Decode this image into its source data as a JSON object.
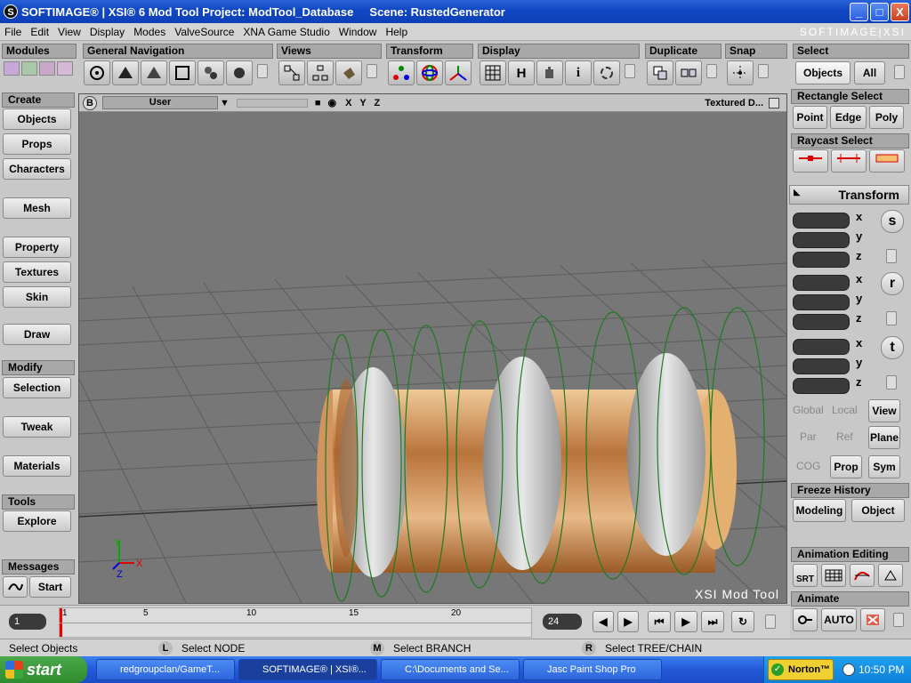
{
  "titlebar": {
    "app_icon": "S",
    "title": "SOFTIMAGE® | XSI® 6 Mod Tool Project: ModTool_Database     Scene: RustedGenerator"
  },
  "window_controls": {
    "minimize": "_",
    "maximize": "□",
    "close": "X"
  },
  "menu": [
    "File",
    "Edit",
    "View",
    "Display",
    "Modes",
    "ValveSource",
    "XNA Game Studio",
    "Window",
    "Help"
  ],
  "brand": "SOFTIMAGE|XSI",
  "toolbar": {
    "modules": "Modules",
    "general_navigation": "General Navigation",
    "views": "Views",
    "transform": "Transform",
    "display": "Display",
    "display_h": "H",
    "display_i": "i",
    "duplicate": "Duplicate",
    "snap": "Snap",
    "select": "Select"
  },
  "left": {
    "create_header": "Create",
    "objects": "Objects",
    "props": "Props",
    "characters": "Characters",
    "mesh": "Mesh",
    "property": "Property",
    "textures": "Textures",
    "skin": "Skin",
    "draw": "Draw",
    "modify_header": "Modify",
    "selection": "Selection",
    "tweak": "Tweak",
    "materials": "Materials",
    "tools_header": "Tools",
    "explore": "Explore",
    "messages_header": "Messages",
    "start": "Start"
  },
  "viewport": {
    "b_label": "B",
    "camera": "User",
    "axes": "X Y Z",
    "mode": "Textured D...",
    "watermark": "XSI Mod Tool",
    "gizmo_y": "Y",
    "gizmo_x": "X",
    "gizmo_z": "Z"
  },
  "right": {
    "objects": "Objects",
    "all": "All",
    "rect_select": "Rectangle Select",
    "point": "Point",
    "edge": "Edge",
    "poly": "Poly",
    "raycast_select": "Raycast Select",
    "transform": "Transform",
    "x": "x",
    "y": "y",
    "z": "z",
    "s": "s",
    "r": "r",
    "t": "t",
    "global": "Global",
    "local": "Local",
    "view": "View",
    "par": "Par",
    "ref": "Ref",
    "plane": "Plane",
    "cog": "COG",
    "prop": "Prop",
    "sym": "Sym",
    "freeze_history": "Freeze History",
    "modeling": "Modeling",
    "object": "Object",
    "animation_editing": "Animation Editing",
    "srt": "SRT",
    "animate": "Animate",
    "auto": "AUTO"
  },
  "timeline": {
    "current_frame": "1",
    "ticks": [
      "1",
      "5",
      "10",
      "15",
      "20"
    ],
    "end_frame": "24"
  },
  "status": {
    "left": "Select Objects",
    "l_key": "L",
    "l_text": "Select NODE",
    "m_key": "M",
    "m_text": "Select BRANCH",
    "r_key": "R",
    "r_text": "Select TREE/CHAIN"
  },
  "taskbar": {
    "start": "start",
    "tasks": [
      "redgroupclan/GameT...",
      "SOFTIMAGE® | XSI®...",
      "C:\\Documents and Se...",
      "Jasc Paint Shop Pro"
    ],
    "norton": "Norton™",
    "clock": "10:50 PM"
  },
  "colors": {
    "title_blue": "#0d3fb6",
    "panel_gray": "#c8c8c8",
    "viewport_gray": "#777777",
    "grid_line": "#5a5a5a",
    "start_green": "#2f8c2f",
    "ring_green": "#1f7a1f"
  }
}
